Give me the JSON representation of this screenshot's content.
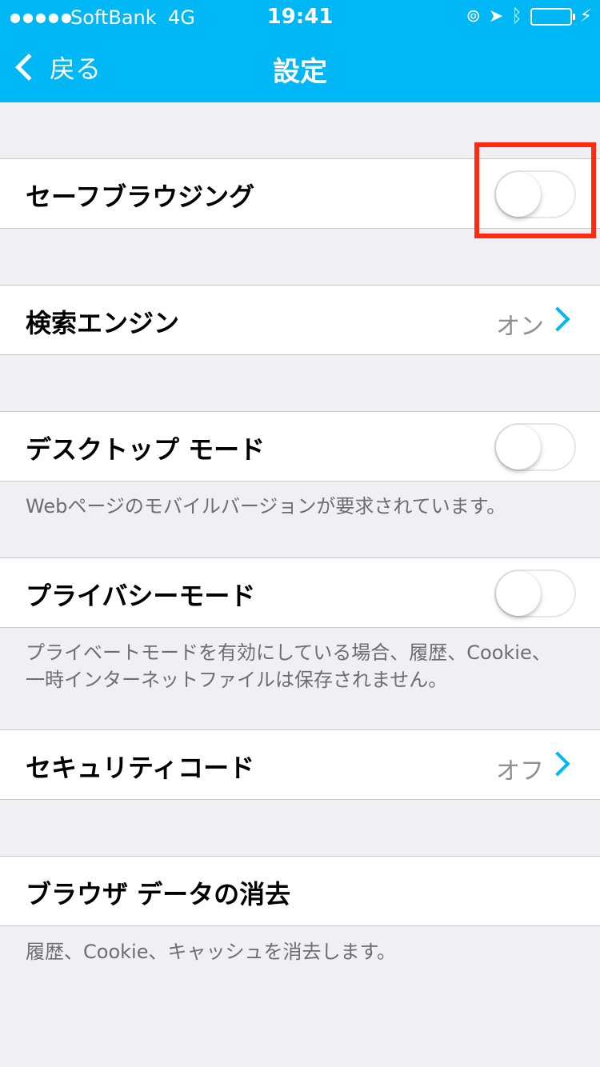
{
  "status_bar": {
    "signal": "●●●●●",
    "carrier": "SoftBank",
    "network": "4G",
    "time": "19:41",
    "icons": [
      "rotation-lock-icon",
      "location-icon",
      "bluetooth-icon",
      "battery-icon",
      "charging-icon"
    ]
  },
  "nav": {
    "back_label": "戻る",
    "title": "設定"
  },
  "settings": {
    "safe_browsing": {
      "label": "セーフブラウジング",
      "on": false
    },
    "search_engine": {
      "label": "検索エンジン",
      "value": "オン"
    },
    "desktop_mode": {
      "label": "デスクトップ モード",
      "on": false,
      "note": "Webページのモバイルバージョンが要求されています。"
    },
    "privacy_mode": {
      "label": "プライバシーモード",
      "on": false,
      "note_line1": "プライベートモードを有効にしている場合、履歴、Cookie、",
      "note_line2": "一時インターネットファイルは保存されません。"
    },
    "security_code": {
      "label": "セキュリティコード",
      "value": "オフ"
    },
    "clear_data": {
      "label": "ブラウザ データの消去",
      "note": "履歴、Cookie、キャッシュを消去します。"
    }
  },
  "colors": {
    "header": "#00b7f5",
    "highlight": "#ff2a10",
    "chevron": "#00b7f5"
  }
}
